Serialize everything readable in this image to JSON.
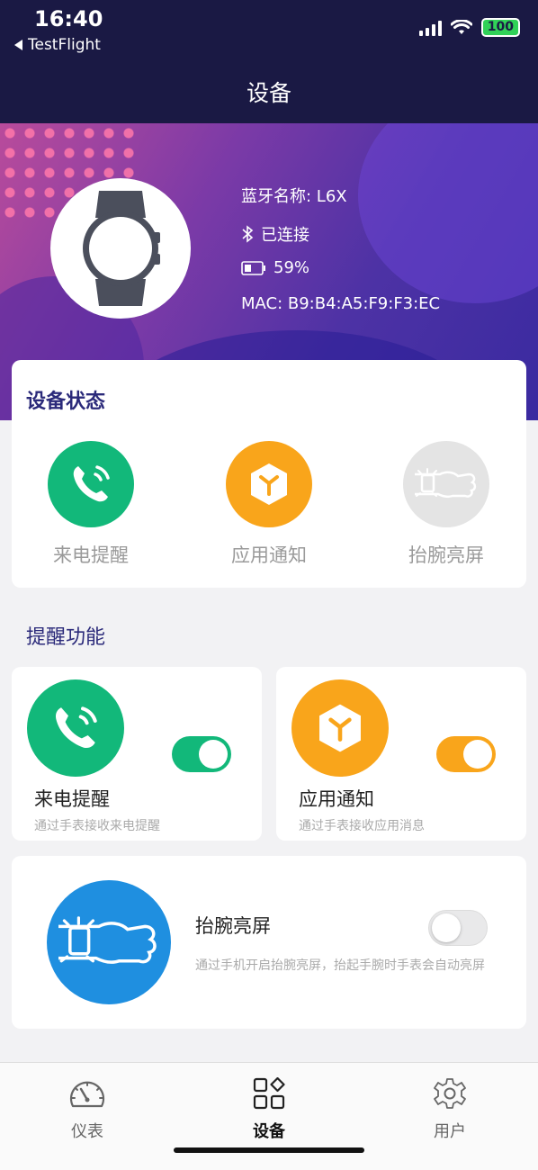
{
  "status_bar": {
    "time": "16:40",
    "back_app": "TestFlight",
    "battery": "100"
  },
  "header": {
    "title": "设备"
  },
  "device": {
    "bluetooth_name": "蓝牙名称: L6X",
    "connection_status": "已连接",
    "battery_level": "59%",
    "mac": "MAC: B9:B4:A5:F9:F3:EC"
  },
  "status_card": {
    "title": "设备状态",
    "items": [
      {
        "label": "来电提醒",
        "icon": "phone-icon",
        "color": "#12b87a",
        "active": true
      },
      {
        "label": "应用通知",
        "icon": "cube-icon",
        "color": "#f9a51b",
        "active": true
      },
      {
        "label": "抬腕亮屏",
        "icon": "wrist-icon",
        "color": "#e4e4e4",
        "active": false
      }
    ]
  },
  "reminders": {
    "section_title": "提醒功能",
    "call": {
      "title": "来电提醒",
      "desc": "通过手表接收来电提醒",
      "enabled": true,
      "color": "#12b87a"
    },
    "app": {
      "title": "应用通知",
      "desc": "通过手表接收应用消息",
      "enabled": true,
      "color": "#f9a51b"
    },
    "wrist": {
      "title": "抬腕亮屏",
      "desc": "通过手机开启抬腕亮屏，抬起手腕时手表会自动亮屏",
      "enabled": false,
      "color": "#1f8fe0"
    }
  },
  "tabs": [
    {
      "label": "仪表",
      "icon": "dashboard-icon",
      "active": false
    },
    {
      "label": "设备",
      "icon": "grid-icon",
      "active": true
    },
    {
      "label": "用户",
      "icon": "gear-icon",
      "active": false
    }
  ]
}
